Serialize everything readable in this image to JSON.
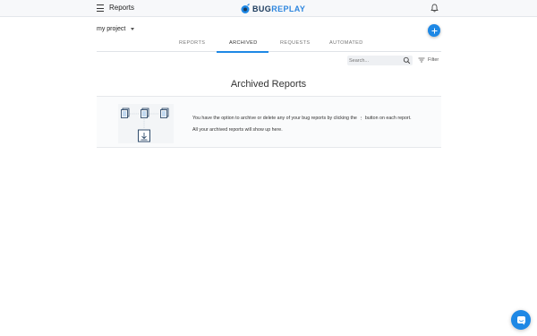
{
  "header": {
    "title": "Reports",
    "logo_text_a": "BUG",
    "logo_text_b": "REPLAY",
    "menu_icon": "hamburger-icon",
    "notification_icon": "bell-icon"
  },
  "project": {
    "name": "my project"
  },
  "tabs": [
    {
      "label": "REPORTS",
      "active": false
    },
    {
      "label": "ARCHIVED",
      "active": true
    },
    {
      "label": "REQUESTS",
      "active": false
    },
    {
      "label": "AUTOMATED",
      "active": false
    }
  ],
  "search": {
    "placeholder": "Search..."
  },
  "filter": {
    "label": "Filter"
  },
  "main": {
    "heading": "Archived Reports",
    "message_line1_a": "You have the option to archive or delete any of your bug reports by clicking the",
    "message_dots": "⋮",
    "message_line1_b": "button on each report.",
    "message_line2": "All your archived reports will show up here."
  },
  "colors": {
    "accent": "#1e88e5",
    "brand_dark": "#1b3a5c",
    "topbar_bg": "#f7f8fa"
  }
}
